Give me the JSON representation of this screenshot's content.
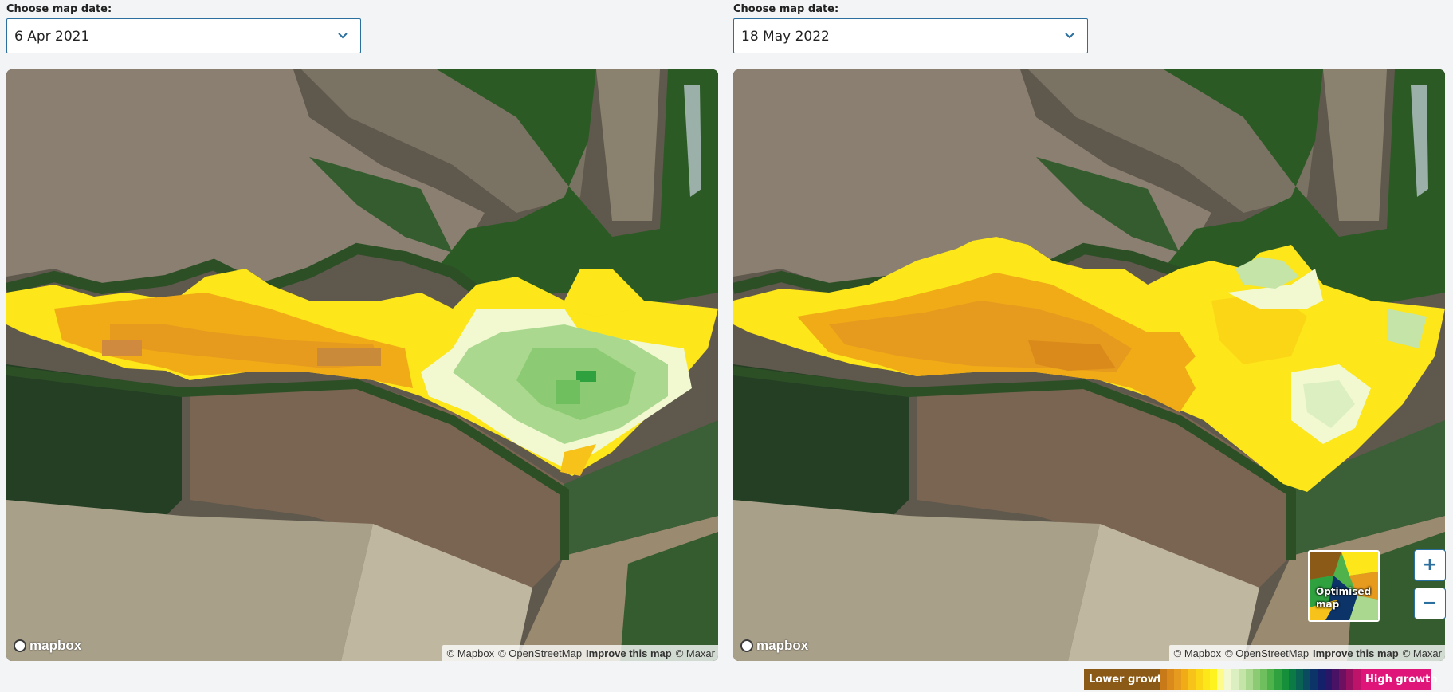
{
  "left_panel": {
    "label": "Choose map date:",
    "selected_date": "6 Apr 2021",
    "logo_text": "mapbox",
    "attribution": {
      "mapbox": "© Mapbox",
      "osm": "© OpenStreetMap",
      "improve": "Improve this map",
      "maxar": "© Maxar"
    }
  },
  "right_panel": {
    "label": "Choose map date:",
    "selected_date": "18 May 2022",
    "logo_text": "mapbox",
    "attribution": {
      "mapbox": "© Mapbox",
      "osm": "© OpenStreetMap",
      "improve": "Improve this map",
      "maxar": "© Maxar"
    },
    "thumbnail_label": "Optimised map",
    "zoom_in": "+",
    "zoom_out": "−"
  },
  "legend": {
    "low_label": "Lower growth",
    "high_label": "High growth",
    "colors": [
      "#c77a17",
      "#d98a1a",
      "#e69a1e",
      "#f0ab17",
      "#f7c21a",
      "#fbd617",
      "#fde619",
      "#fff31f",
      "#fffb8a",
      "#f2f9d0",
      "#dcefc0",
      "#c4e4a8",
      "#a9d88e",
      "#8ccb73",
      "#6fbf5e",
      "#4fb24a",
      "#2fa23f",
      "#168f3a",
      "#0b7a44",
      "#0a6253",
      "#0b4b60",
      "#0c3468",
      "#14206a",
      "#2a1666",
      "#4a1264",
      "#6e1060",
      "#951061",
      "#bd1368"
    ],
    "low_color": "#8b5a16",
    "high_color": "#e0157a"
  }
}
